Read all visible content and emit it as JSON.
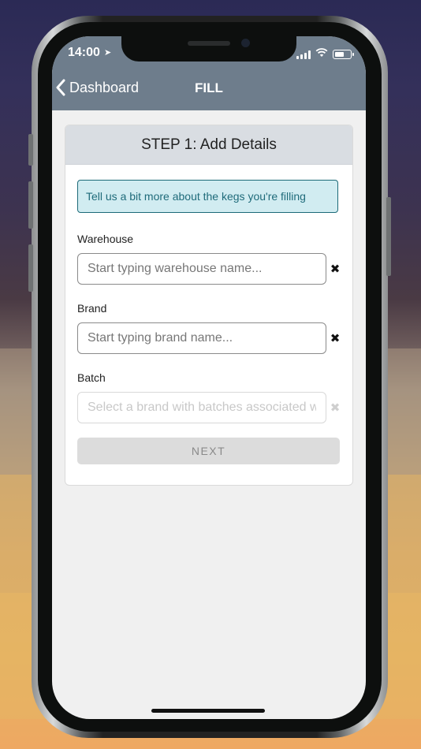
{
  "status_bar": {
    "time": "14:00",
    "icons": [
      "location-arrow-icon",
      "signal-icon",
      "wifi-icon",
      "battery-icon"
    ]
  },
  "nav": {
    "back_label": "Dashboard",
    "title": "FILL"
  },
  "card": {
    "header": "STEP 1: Add Details",
    "info_text": "Tell us a bit more about the kegs you're filling"
  },
  "form": {
    "warehouse": {
      "label": "Warehouse",
      "placeholder": "Start typing warehouse name...",
      "value": "",
      "clear_symbol": "✖"
    },
    "brand": {
      "label": "Brand",
      "placeholder": "Start typing brand name...",
      "value": "",
      "clear_symbol": "✖"
    },
    "batch": {
      "label": "Batch",
      "placeholder": "Select a brand with batches associated with it",
      "value": "",
      "clear_symbol": "✖",
      "disabled": true
    },
    "next_label": "NEXT"
  },
  "colors": {
    "nav_bar": "#6e7d8c",
    "card_header": "#d9dde2",
    "info_bg": "#d1ecf1",
    "info_border": "#1c6a78",
    "button_disabled": "#dcdcdc"
  }
}
